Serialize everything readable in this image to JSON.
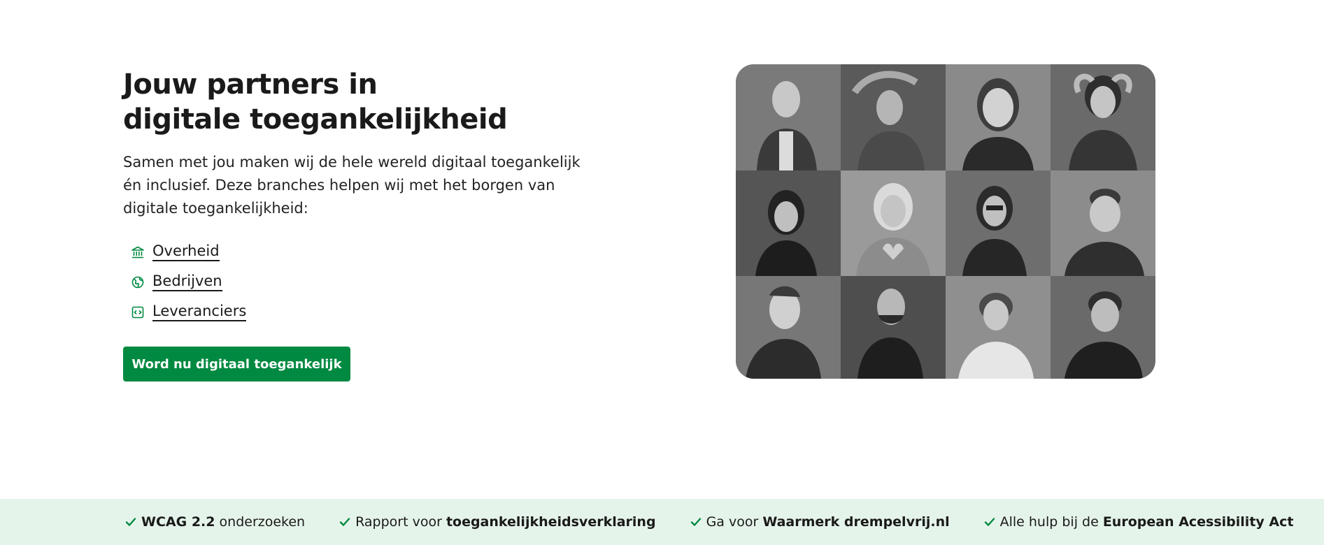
{
  "hero": {
    "title_line1": "Jouw partners in",
    "title_line2": "digitale toegankelijkheid",
    "intro_line1": "Samen met jou maken wij de hele wereld digitaal toegankelijk",
    "intro_line2": "én inclusief. Deze branches helpen wij met het borgen van",
    "intro_line3": "digitale toegankelijkheid:",
    "links": [
      {
        "label": "Overheid",
        "icon": "government-building-icon"
      },
      {
        "label": "Bedrijven",
        "icon": "globe-icon"
      },
      {
        "label": "Leveranciers",
        "icon": "code-icon"
      }
    ],
    "cta_label": "Word nu digitaal toegankelijk",
    "photo_grid": {
      "tiles": 12,
      "style": "black-and-white portraits"
    }
  },
  "usp_bar": {
    "items": [
      {
        "bold_first": "WCAG 2.2",
        "normal": " onderzoeken"
      },
      {
        "normal": "Rapport voor ",
        "bold": "toegankelijkheidsverklaring"
      },
      {
        "normal": "Ga voor ",
        "bold": "Waarmerk drempelvrij.nl"
      },
      {
        "normal": "Alle hulp bij de ",
        "bold": "European Acessibility Act"
      }
    ]
  },
  "colors": {
    "accent": "#008940",
    "usp_background": "#e5f4ea",
    "text": "#1a1a1a"
  }
}
